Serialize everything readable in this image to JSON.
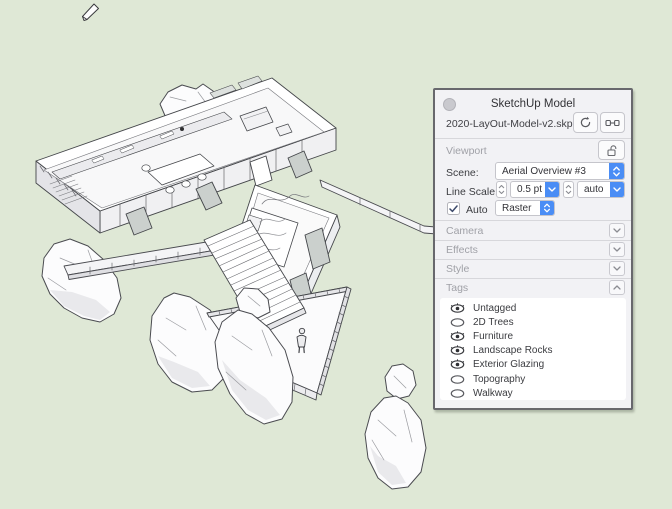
{
  "canvas": {
    "description": "Axonometric line-art SketchUp house model on green paper",
    "background_color": "#dfe8d6",
    "figure": "person-scale-figure-on-deck",
    "cursor_tool": "pencil"
  },
  "panel": {
    "title": "SketchUp Model",
    "filename": "2020-LayOut-Model-v2.skp",
    "viewport": {
      "section_label": "Viewport",
      "scene_label": "Scene:",
      "scene_value": "Aerial Overview #3",
      "line_scale_label": "Line Scale:",
      "line_scale_value": "0.5 pt",
      "line_scale_mode_value": "auto",
      "auto_label": "Auto",
      "auto_checked": true,
      "render_mode_value": "Raster"
    },
    "sections": [
      {
        "label": "Camera",
        "expanded": false
      },
      {
        "label": "Effects",
        "expanded": false
      },
      {
        "label": "Style",
        "expanded": false
      },
      {
        "label": "Tags",
        "expanded": true
      }
    ],
    "tags": {
      "items": [
        {
          "label": "Untagged",
          "visible": true
        },
        {
          "label": "2D Trees",
          "visible": false
        },
        {
          "label": "Furniture",
          "visible": true
        },
        {
          "label": "Landscape Rocks",
          "visible": true
        },
        {
          "label": "Exterior Glazing",
          "visible": true
        },
        {
          "label": "Topography",
          "visible": false
        },
        {
          "label": "Walkway",
          "visible": false
        }
      ]
    },
    "icons": {
      "refresh": "circular-arrow",
      "link": "document-link",
      "lock": "open-padlock",
      "eye_visible": "open-eye",
      "eye_hidden": "closed-eye-ellipse"
    },
    "colors": {
      "accent_blue": "#4a8df5",
      "panel_bg": "#f2f2f5"
    }
  }
}
